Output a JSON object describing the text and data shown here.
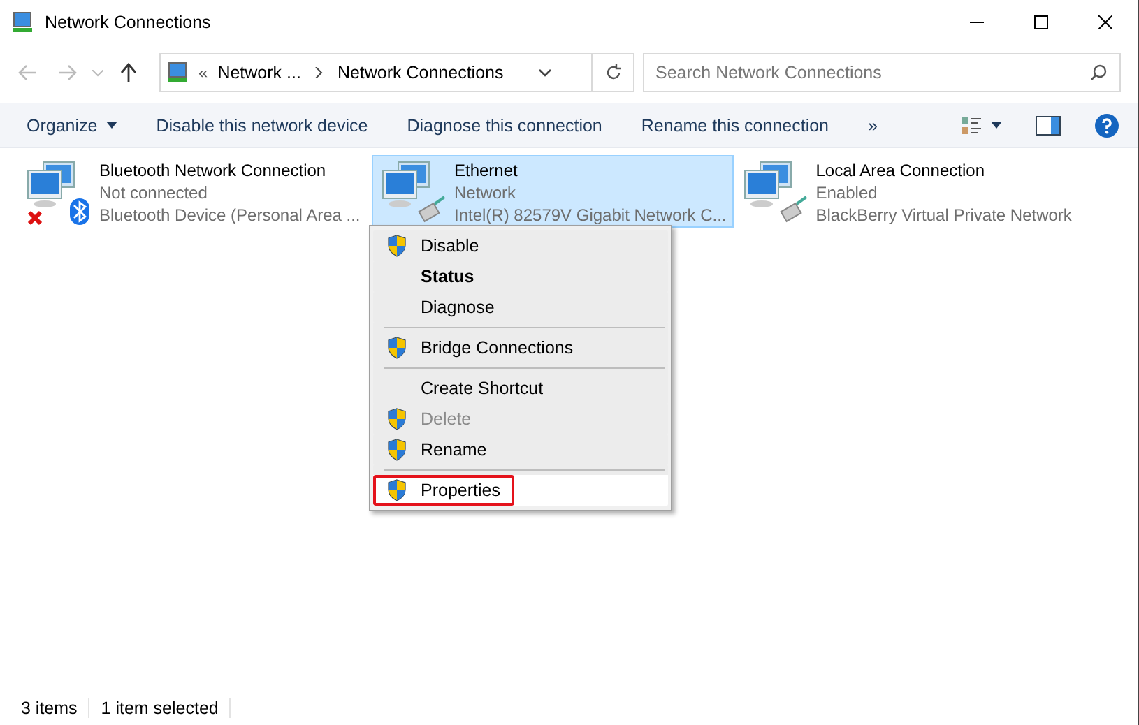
{
  "window": {
    "title": "Network Connections"
  },
  "address": {
    "crumbs": [
      "Network ...",
      "Network Connections"
    ],
    "overflow": "«"
  },
  "search": {
    "placeholder": "Search Network Connections"
  },
  "commands": [
    {
      "label": "Organize",
      "kind": "dropdown"
    },
    {
      "label": "Disable this network device",
      "kind": "plain"
    },
    {
      "label": "Diagnose this connection",
      "kind": "plain"
    },
    {
      "label": "Rename this connection",
      "kind": "plain"
    },
    {
      "label": "»",
      "kind": "plain"
    }
  ],
  "connections": [
    {
      "name": "Bluetooth Network Connection",
      "status": "Not connected",
      "device": "Bluetooth Device (Personal Area ...",
      "kind": "bluetooth",
      "disconnected": true,
      "selected": false
    },
    {
      "name": "Ethernet",
      "status": "Network",
      "device": "Intel(R) 82579V Gigabit Network C...",
      "kind": "cable",
      "disconnected": false,
      "selected": true
    },
    {
      "name": "Local Area Connection",
      "status": "Enabled",
      "device": "BlackBerry Virtual Private Network",
      "kind": "cable",
      "disconnected": false,
      "selected": false
    }
  ],
  "context_menu": [
    {
      "label": "Disable",
      "shield": true,
      "bold": false,
      "disabled": false,
      "separator_before": false,
      "highlighted": false
    },
    {
      "label": "Status",
      "shield": false,
      "bold": true,
      "disabled": false,
      "separator_before": false,
      "highlighted": false
    },
    {
      "label": "Diagnose",
      "shield": false,
      "bold": false,
      "disabled": false,
      "separator_before": false,
      "highlighted": false
    },
    {
      "label": "Bridge Connections",
      "shield": true,
      "bold": false,
      "disabled": false,
      "separator_before": true,
      "highlighted": false
    },
    {
      "label": "Create Shortcut",
      "shield": false,
      "bold": false,
      "disabled": false,
      "separator_before": true,
      "highlighted": false
    },
    {
      "label": "Delete",
      "shield": true,
      "bold": false,
      "disabled": true,
      "separator_before": false,
      "highlighted": false
    },
    {
      "label": "Rename",
      "shield": true,
      "bold": false,
      "disabled": false,
      "separator_before": false,
      "highlighted": false
    },
    {
      "label": "Properties",
      "shield": true,
      "bold": false,
      "disabled": false,
      "separator_before": true,
      "highlighted": true
    }
  ],
  "status_bar": [
    "3 items",
    "1 item selected"
  ]
}
